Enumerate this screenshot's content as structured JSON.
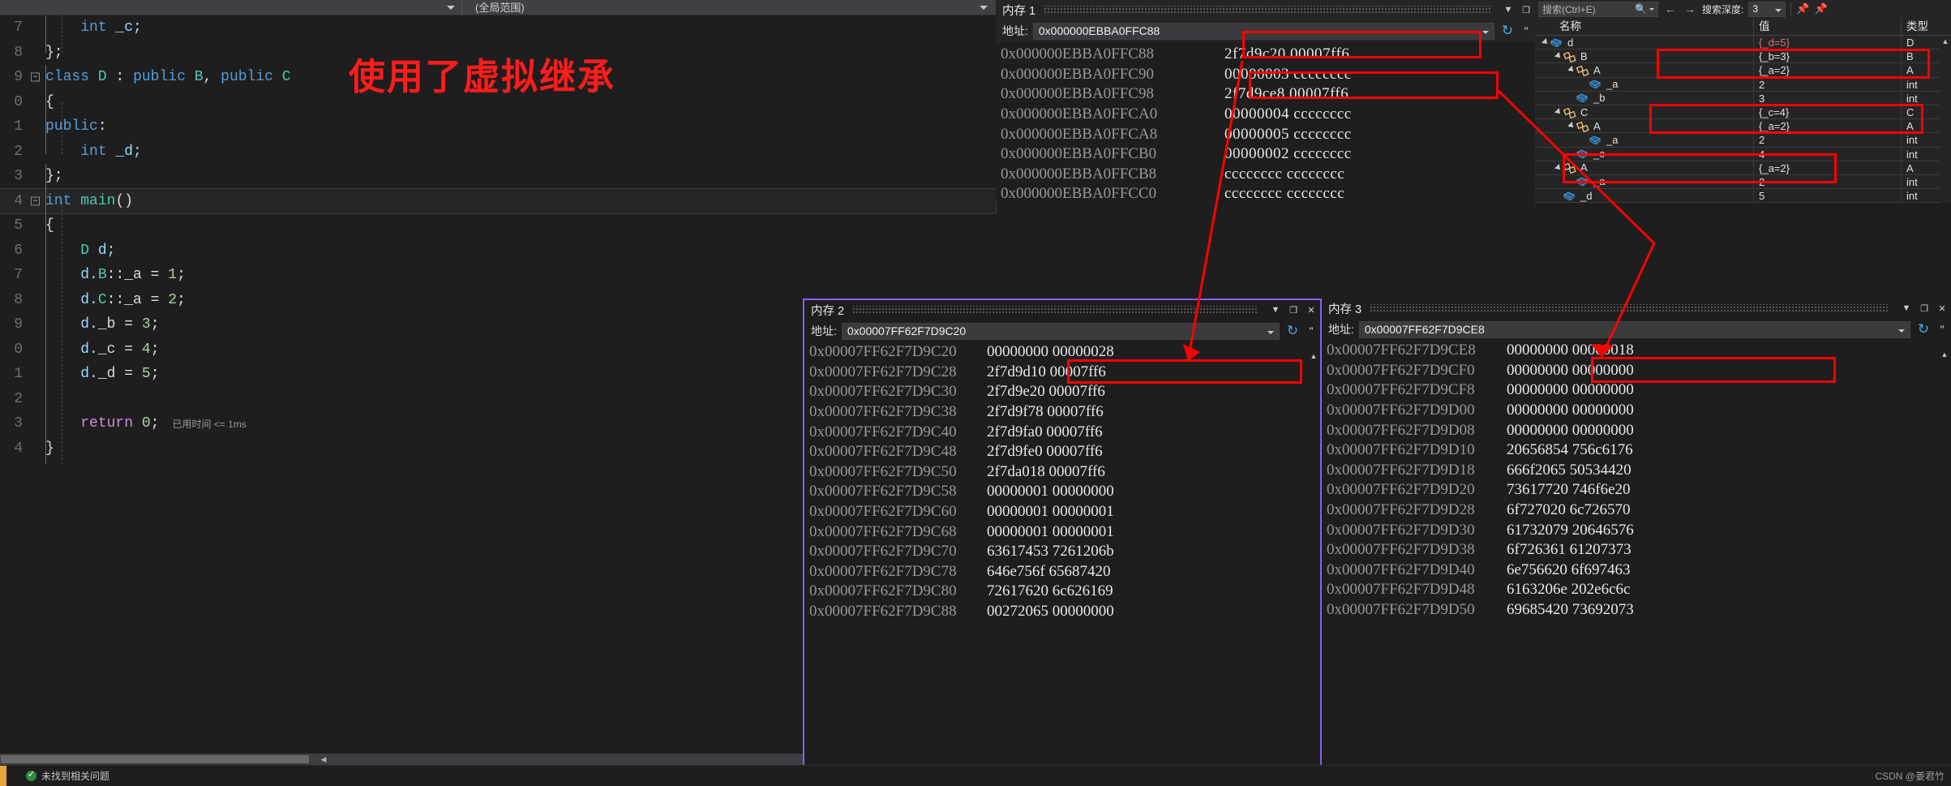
{
  "editor": {
    "nav_scope": "(全局范围)",
    "annotation": "使用了虚拟继承",
    "elapsed": "已用时间 <= 1ms",
    "lines": [
      {
        "no": "7",
        "text": "        int _c;"
      },
      {
        "no": "8",
        "text": "    };"
      },
      {
        "no": "9",
        "text": "    class D : public B, public C"
      },
      {
        "no": "0",
        "text": "    {"
      },
      {
        "no": "1",
        "text": "    public:"
      },
      {
        "no": "2",
        "text": "        int _d;"
      },
      {
        "no": "3",
        "text": "    };"
      },
      {
        "no": "4",
        "text": "    int main()"
      },
      {
        "no": "5",
        "text": "    {"
      },
      {
        "no": "6",
        "text": "        D d;"
      },
      {
        "no": "7",
        "text": "        d.B::_a = 1;"
      },
      {
        "no": "8",
        "text": "        d.C::_a = 2;"
      },
      {
        "no": "9",
        "text": "        d._b = 3;"
      },
      {
        "no": "0",
        "text": "        d._c = 4;"
      },
      {
        "no": "1",
        "text": "        d._d = 5;"
      },
      {
        "no": "2",
        "text": ""
      },
      {
        "no": "3",
        "text": "        return 0;"
      },
      {
        "no": "4",
        "text": "    }"
      }
    ]
  },
  "memory1": {
    "title": "内存 1",
    "address_label": "地址:",
    "address_value": "0x000000EBBA0FFC88",
    "refresh_icon": "refresh-icon",
    "rows": [
      {
        "addr": "0x000000EBBA0FFC88",
        "data": "2f7d9c20  00007ff6"
      },
      {
        "addr": "0x000000EBBA0FFC90",
        "data": "00000003  cccccccc"
      },
      {
        "addr": "0x000000EBBA0FFC98",
        "data": "2f7d9ce8  00007ff6"
      },
      {
        "addr": "0x000000EBBA0FFCA0",
        "data": "00000004  cccccccc"
      },
      {
        "addr": "0x000000EBBA0FFCA8",
        "data": "00000005  cccccccc"
      },
      {
        "addr": "0x000000EBBA0FFCB0",
        "data": "00000002  cccccccc"
      },
      {
        "addr": "0x000000EBBA0FFCB8",
        "data": "cccccccc  cccccccc"
      },
      {
        "addr": "0x000000EBBA0FFCC0",
        "data": "cccccccc  cccccccc"
      }
    ]
  },
  "memory2": {
    "title": "内存 2",
    "address_label": "地址:",
    "address_value": "0x00007FF62F7D9C20",
    "rows": [
      {
        "addr": "0x00007FF62F7D9C20",
        "data": "00000000  00000028"
      },
      {
        "addr": "0x00007FF62F7D9C28",
        "data": "2f7d9d10  00007ff6"
      },
      {
        "addr": "0x00007FF62F7D9C30",
        "data": "2f7d9e20  00007ff6"
      },
      {
        "addr": "0x00007FF62F7D9C38",
        "data": "2f7d9f78  00007ff6"
      },
      {
        "addr": "0x00007FF62F7D9C40",
        "data": "2f7d9fa0  00007ff6"
      },
      {
        "addr": "0x00007FF62F7D9C48",
        "data": "2f7d9fe0  00007ff6"
      },
      {
        "addr": "0x00007FF62F7D9C50",
        "data": "2f7da018  00007ff6"
      },
      {
        "addr": "0x00007FF62F7D9C58",
        "data": "00000001  00000000"
      },
      {
        "addr": "0x00007FF62F7D9C60",
        "data": "00000001  00000001"
      },
      {
        "addr": "0x00007FF62F7D9C68",
        "data": "00000001  00000001"
      },
      {
        "addr": "0x00007FF62F7D9C70",
        "data": "63617453  7261206b"
      },
      {
        "addr": "0x00007FF62F7D9C78",
        "data": "646e756f  65687420"
      },
      {
        "addr": "0x00007FF62F7D9C80",
        "data": "72617620  6c626169"
      },
      {
        "addr": "0x00007FF62F7D9C88",
        "data": "00272065  00000000"
      }
    ]
  },
  "memory3": {
    "title": "内存 3",
    "address_label": "地址:",
    "address_value": "0x00007FF62F7D9CE8",
    "rows": [
      {
        "addr": "0x00007FF62F7D9CE8",
        "data": "00000000  00000018"
      },
      {
        "addr": "0x00007FF62F7D9CF0",
        "data": "00000000  00000000"
      },
      {
        "addr": "0x00007FF62F7D9CF8",
        "data": "00000000  00000000"
      },
      {
        "addr": "0x00007FF62F7D9D00",
        "data": "00000000  00000000"
      },
      {
        "addr": "0x00007FF62F7D9D08",
        "data": "00000000  00000000"
      },
      {
        "addr": "0x00007FF62F7D9D10",
        "data": "20656854  756c6176"
      },
      {
        "addr": "0x00007FF62F7D9D18",
        "data": "666f2065  50534420"
      },
      {
        "addr": "0x00007FF62F7D9D20",
        "data": "73617720  746f6e20"
      },
      {
        "addr": "0x00007FF62F7D9D28",
        "data": "6f727020  6c726570"
      },
      {
        "addr": "0x00007FF62F7D9D30",
        "data": "61732079  20646576"
      },
      {
        "addr": "0x00007FF62F7D9D38",
        "data": "6f726361  61207373"
      },
      {
        "addr": "0x00007FF62F7D9D40",
        "data": "6e756620  6f697463"
      },
      {
        "addr": "0x00007FF62F7D9D48",
        "data": "6163206e",
        "data2": "202e6c6c"
      },
      {
        "addr": "0x00007FF62F7D9D50",
        "data": "69685420  73692073"
      }
    ]
  },
  "watch": {
    "search_placeholder": "搜索(Ctrl+E)",
    "search_icon": "search-icon",
    "back_icon": "arrow-left-icon",
    "forward_icon": "arrow-right-icon",
    "depth_label": "搜索深度:",
    "depth_value": "3",
    "columns": {
      "name": "名称",
      "value": "值",
      "type": "类型"
    },
    "rows": [
      {
        "indent": 0,
        "expander": true,
        "icon": "field-cube-icon",
        "name": "d",
        "value": "{_d=5}",
        "type": "D",
        "modified": true
      },
      {
        "indent": 1,
        "expander": true,
        "icon": "base-class-icon",
        "name": "B",
        "value": "{_b=3}",
        "type": "B",
        "modified": false
      },
      {
        "indent": 2,
        "expander": true,
        "icon": "base-class-icon",
        "name": "A",
        "value": "{_a=2}",
        "type": "A",
        "modified": false
      },
      {
        "indent": 3,
        "expander": false,
        "icon": "field-cube-icon",
        "name": "_a",
        "value": "2",
        "type": "int",
        "modified": false
      },
      {
        "indent": 2,
        "expander": false,
        "icon": "field-cube-icon",
        "name": "_b",
        "value": "3",
        "type": "int",
        "modified": false
      },
      {
        "indent": 1,
        "expander": true,
        "icon": "base-class-icon",
        "name": "C",
        "value": "{_c=4}",
        "type": "C",
        "modified": false
      },
      {
        "indent": 2,
        "expander": true,
        "icon": "base-class-icon",
        "name": "A",
        "value": "{_a=2}",
        "type": "A",
        "modified": false
      },
      {
        "indent": 3,
        "expander": false,
        "icon": "field-cube-icon",
        "name": "_a",
        "value": "2",
        "type": "int",
        "modified": false
      },
      {
        "indent": 2,
        "expander": false,
        "icon": "field-cube-icon",
        "name": "_c",
        "value": "4",
        "type": "int",
        "modified": false
      },
      {
        "indent": 1,
        "expander": true,
        "icon": "base-class-icon",
        "name": "A",
        "value": "{_a=2}",
        "type": "A",
        "modified": false
      },
      {
        "indent": 2,
        "expander": false,
        "icon": "field-cube-icon",
        "name": "_a",
        "value": "2",
        "type": "int",
        "modified": false
      },
      {
        "indent": 1,
        "expander": false,
        "icon": "field-cube-icon",
        "name": "_d",
        "value": "5",
        "type": "int",
        "modified": false
      }
    ]
  },
  "statusbar": {
    "message": "未找到相关问题",
    "watermark": "CSDN @姜君竹"
  }
}
